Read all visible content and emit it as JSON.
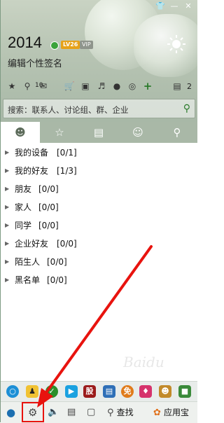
{
  "window_controls": {
    "skin_label": "换肤",
    "min_label": "—",
    "close_label": "✕"
  },
  "profile": {
    "nickname": "2014",
    "level_badge": "LV26",
    "vip_badge": "VIP",
    "signature": "编辑个性签名",
    "mail_count": "10",
    "msgbox_count": "2"
  },
  "search": {
    "placeholder": "搜索：联系人、讨论组、群、企业"
  },
  "tabs": [
    {
      "name": "contacts",
      "icon": "person-icon"
    },
    {
      "name": "favorites",
      "icon": "star-icon"
    },
    {
      "name": "groups",
      "icon": "chat-icon"
    },
    {
      "name": "discussions",
      "icon": "people-icon"
    },
    {
      "name": "recent",
      "icon": "history-icon"
    }
  ],
  "groups": [
    {
      "name": "我的设备",
      "count": "[0/1]"
    },
    {
      "name": "我的好友",
      "count": "[1/3]"
    },
    {
      "name": "朋友",
      "count": "[0/0]"
    },
    {
      "name": "家人",
      "count": "[0/0]"
    },
    {
      "name": "同学",
      "count": "[0/0]"
    },
    {
      "name": "企业好友",
      "count": "[0/0]"
    },
    {
      "name": "陌生人",
      "count": "[0/0]"
    },
    {
      "name": "黑名单",
      "count": "[0/0]"
    }
  ],
  "apps": {
    "stock_label": "股",
    "free_label": "免"
  },
  "toolbar": {
    "find_label": "查找",
    "appbox_label": "应用宝"
  },
  "watermark": "Baidu",
  "colors": {
    "accent_green": "#2a7a2a",
    "highlight_red": "#e8130e",
    "header_bg": "#b7c4b3"
  }
}
